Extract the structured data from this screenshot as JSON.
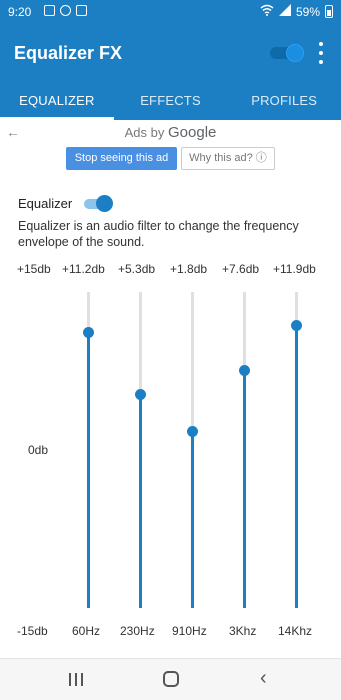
{
  "status_bar": {
    "time": "9:20",
    "battery": "59%",
    "icons": [
      "notification-icon",
      "messenger-icon",
      "sync-icon",
      "wifi-icon",
      "signal-icon",
      "battery-icon"
    ]
  },
  "app_bar": {
    "title": "Equalizer FX",
    "master_toggle": "on",
    "menu_icon": "more-vert-icon"
  },
  "tabs": [
    {
      "label": "EQUALIZER",
      "active": true
    },
    {
      "label": "EFFECTS",
      "active": false
    },
    {
      "label": "PROFILES",
      "active": false
    }
  ],
  "ad": {
    "back_icon": "arrow-left-icon",
    "ads_by": "Ads by",
    "brand": "Google",
    "stop_label": "Stop seeing this ad",
    "why_label": "Why this ad? ⓘ"
  },
  "equalizer": {
    "label": "Equalizer",
    "enabled": true,
    "description": "Equalizer is an audio filter to change the frequency envelope of the sound.",
    "max_label": "+15db",
    "zero_label": "0db",
    "min_label": "-15db",
    "bands": [
      {
        "freq": "60Hz",
        "gain_label": "+11.2db",
        "gain": 11.2
      },
      {
        "freq": "230Hz",
        "gain_label": "+5.3db",
        "gain": 5.3
      },
      {
        "freq": "910Hz",
        "gain_label": "+1.8db",
        "gain": 1.8
      },
      {
        "freq": "3Khz",
        "gain_label": "+7.6db",
        "gain": 7.6
      },
      {
        "freq": "14Khz",
        "gain_label": "+11.9db",
        "gain": 11.9
      }
    ]
  },
  "colors": {
    "primary": "#1c7fc4",
    "accent": "#1c7fc4",
    "ad_button": "#4a90e2"
  },
  "nav": {
    "recent_icon": "recent-apps-icon",
    "home_icon": "home-icon",
    "back_icon": "back-icon"
  }
}
